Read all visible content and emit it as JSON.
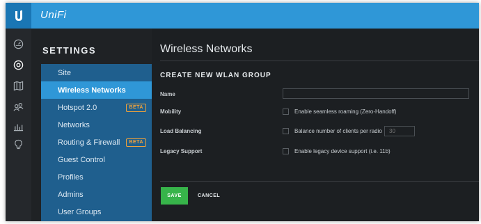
{
  "header": {
    "brand": "UniFi",
    "logo_icon": "ubiquiti-logo-icon",
    "accent_color": "#2f97d7"
  },
  "rail": {
    "icons": [
      "dashboard-icon",
      "devices-icon",
      "map-icon",
      "clients-icon",
      "statistics-icon",
      "insights-icon"
    ]
  },
  "sidebar": {
    "title": "SETTINGS",
    "items": [
      {
        "label": "Site",
        "active": false,
        "badge": ""
      },
      {
        "label": "Wireless Networks",
        "active": true,
        "badge": ""
      },
      {
        "label": "Hotspot 2.0",
        "active": false,
        "badge": "BETA"
      },
      {
        "label": "Networks",
        "active": false,
        "badge": ""
      },
      {
        "label": "Routing & Firewall",
        "active": false,
        "badge": "BETA"
      },
      {
        "label": "Guest Control",
        "active": false,
        "badge": ""
      },
      {
        "label": "Profiles",
        "active": false,
        "badge": ""
      },
      {
        "label": "Admins",
        "active": false,
        "badge": ""
      },
      {
        "label": "User Groups",
        "active": false,
        "badge": ""
      }
    ]
  },
  "main": {
    "page_title": "Wireless Networks",
    "section_heading": "CREATE NEW WLAN GROUP",
    "form": {
      "name_label": "Name",
      "name_value": "",
      "mobility_label": "Mobility",
      "mobility_option": "Enable seamless roaming (Zero-Handoff)",
      "mobility_checked": false,
      "load_balancing_label": "Load Balancing",
      "load_balancing_option": "Balance number of clients per radio",
      "load_balancing_checked": false,
      "clients_per_radio_placeholder": "30",
      "legacy_label": "Legacy Support",
      "legacy_option": "Enable legacy device support (i.e. 11b)",
      "legacy_checked": false
    },
    "actions": {
      "save_label": "SAVE",
      "save_color": "#37b44a",
      "cancel_label": "CANCEL"
    }
  }
}
